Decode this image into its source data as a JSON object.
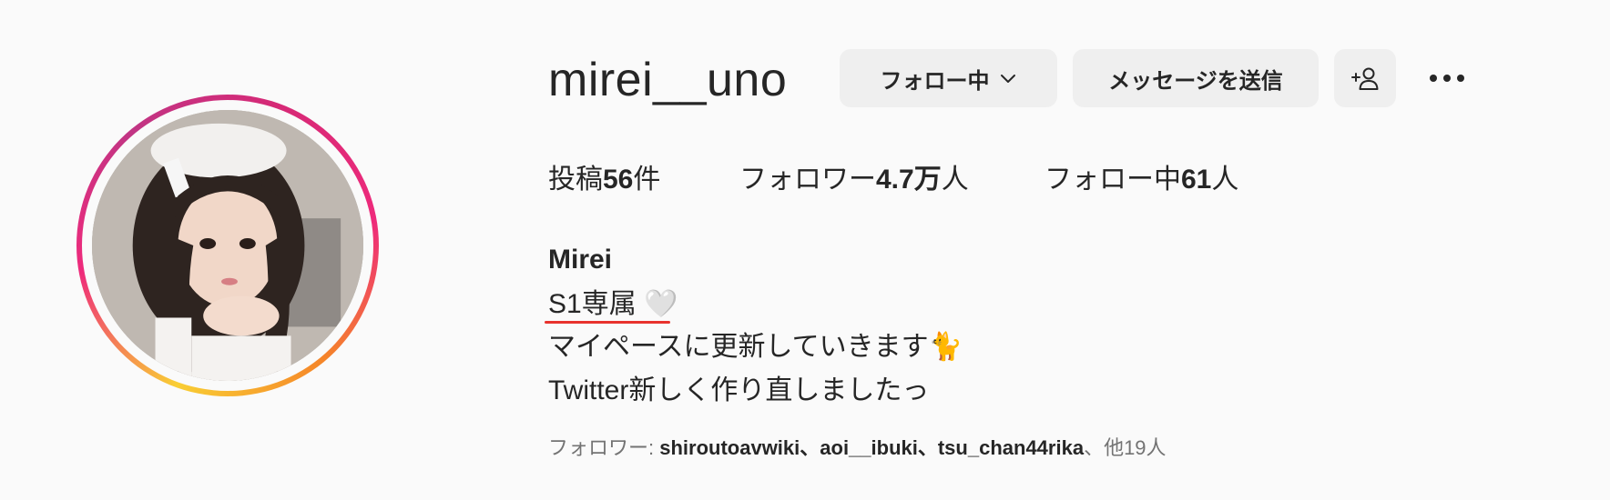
{
  "profile": {
    "username": "mirei__uno",
    "full_name": "Mirei"
  },
  "actions": {
    "follow_label": "フォロー中",
    "message_label": "メッセージを送信",
    "add_user_icon": "add-user-icon",
    "more_icon": "more-horizontal-icon"
  },
  "stats": {
    "posts_prefix": "投稿",
    "posts_value": "56",
    "posts_suffix": "件",
    "followers_prefix": "フォロワー",
    "followers_value": "4.7万",
    "followers_suffix": "人",
    "following_prefix": "フォロー中",
    "following_value": "61",
    "following_suffix": "人"
  },
  "bio": {
    "line1": "S1専属 🤍",
    "line2": "マイペースに更新していきます🐈",
    "line3": "Twitter新しく作り直しましたっ"
  },
  "followed_by": {
    "prefix": "フォロワー: ",
    "names": "shiroutoavwiki、aoi__ibuki、tsu_chan44rika",
    "suffix": "、他19人"
  },
  "colors": {
    "background": "#fafafa",
    "button_bg": "#efefef",
    "annotation_underline": "#e8322d"
  }
}
